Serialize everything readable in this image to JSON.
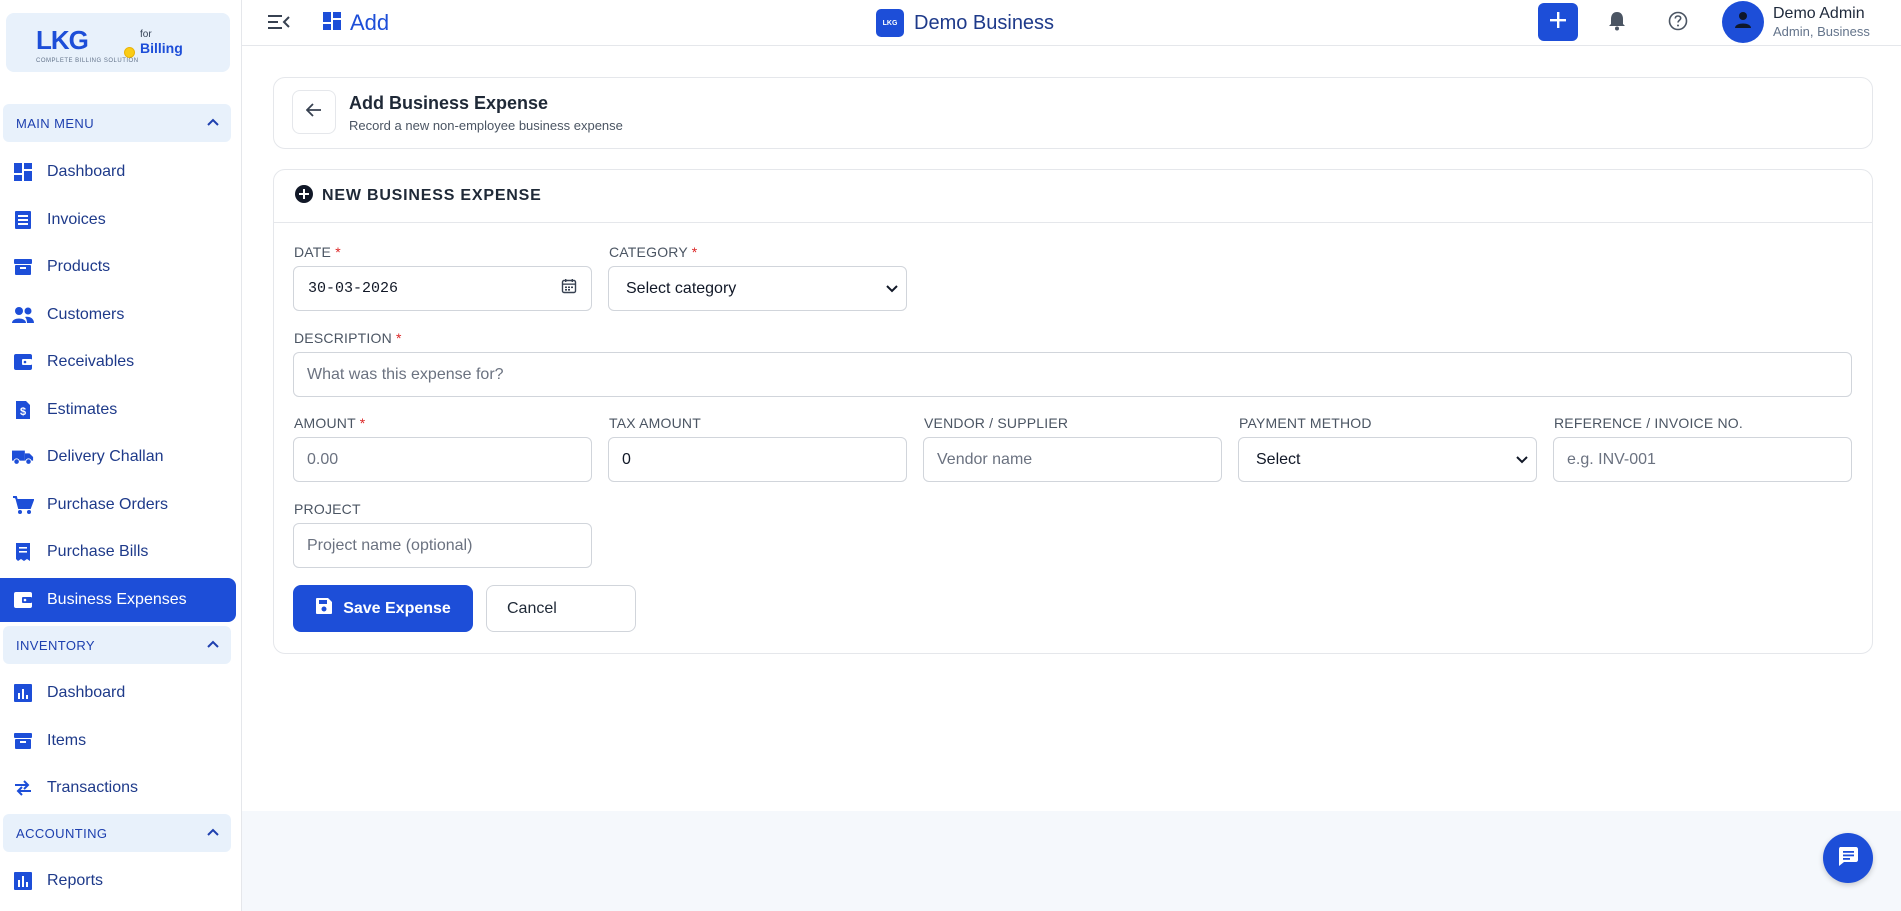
{
  "brand": {
    "logo_text": "LKG",
    "logo_for": "for",
    "logo_billing": "Billing",
    "logo_tagline": "COMPLETE BILLING SOLUTION"
  },
  "sidebar": {
    "main_menu_label": "MAIN MENU",
    "main_items": [
      {
        "label": "Dashboard",
        "icon": "dashboard-icon"
      },
      {
        "label": "Invoices",
        "icon": "invoice-icon"
      },
      {
        "label": "Products",
        "icon": "archive-box-icon"
      },
      {
        "label": "Customers",
        "icon": "people-icon"
      },
      {
        "label": "Receivables",
        "icon": "wallet-icon"
      },
      {
        "label": "Estimates",
        "icon": "dollar-document-icon"
      },
      {
        "label": "Delivery Challan",
        "icon": "truck-icon"
      },
      {
        "label": "Purchase Orders",
        "icon": "cart-icon"
      },
      {
        "label": "Purchase Bills",
        "icon": "receipt-icon"
      },
      {
        "label": "Business Expenses",
        "icon": "wallet-icon",
        "active": true
      }
    ],
    "inventory_label": "INVENTORY",
    "inventory_items": [
      {
        "label": "Dashboard",
        "icon": "chart-icon"
      },
      {
        "label": "Items",
        "icon": "archive-box-icon"
      },
      {
        "label": "Transactions",
        "icon": "swap-arrows-icon"
      }
    ],
    "accounting_label": "ACCOUNTING",
    "accounting_items": [
      {
        "label": "Reports",
        "icon": "bar-chart-icon"
      }
    ]
  },
  "topbar": {
    "add_label": "Add",
    "business_logo_text": "LKG",
    "business_name": "Demo Business",
    "user_name": "Demo Admin",
    "user_role": "Admin, Business"
  },
  "page": {
    "title": "Add Business Expense",
    "subtitle": "Record a new non-employee business expense"
  },
  "form": {
    "section_title": "NEW BUSINESS EXPENSE",
    "date": {
      "label": "DATE",
      "required": "*",
      "value": "30-03-2026"
    },
    "category": {
      "label": "CATEGORY",
      "required": "*",
      "value": "Select category"
    },
    "description": {
      "label": "DESCRIPTION",
      "required": "*",
      "placeholder": "What was this expense for?"
    },
    "amount": {
      "label": "AMOUNT",
      "required": "*",
      "placeholder": "0.00"
    },
    "tax_amount": {
      "label": "TAX AMOUNT",
      "value": "0"
    },
    "vendor": {
      "label": "VENDOR / SUPPLIER",
      "placeholder": "Vendor name"
    },
    "payment_method": {
      "label": "PAYMENT METHOD",
      "value": "Select"
    },
    "reference": {
      "label": "REFERENCE / INVOICE NO.",
      "placeholder": "e.g. INV-001"
    },
    "project": {
      "label": "PROJECT",
      "placeholder": "Project name (optional)"
    },
    "save_label": "Save Expense",
    "cancel_label": "Cancel"
  },
  "colors": {
    "accent": "#1d4ed8",
    "section_bg": "#e8f1fb",
    "required": "#dc2626"
  }
}
